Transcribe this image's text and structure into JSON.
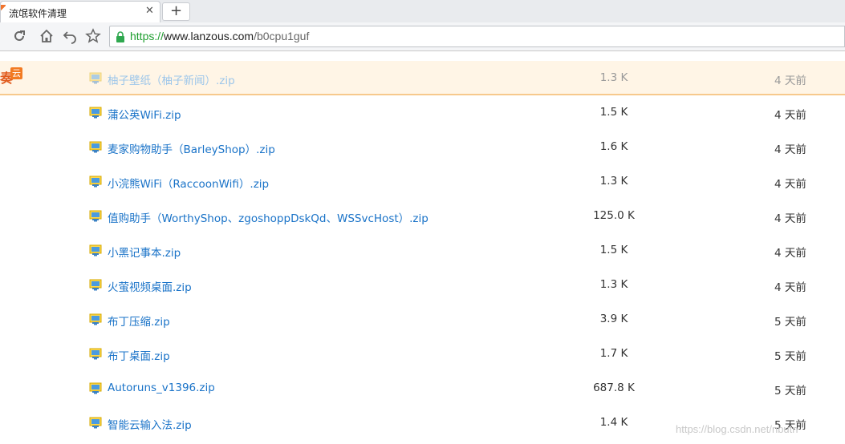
{
  "browser": {
    "tab": {
      "title": "流氓软件清理",
      "close_glyph": "✕"
    },
    "new_tab_glyph": "+",
    "toolbar": {
      "icons": [
        "reload-icon",
        "home-icon",
        "back-icon",
        "bookmark-star-icon"
      ]
    },
    "address": {
      "scheme": "https://",
      "host": "www.lanzous.com",
      "path": "/b0cpu1guf"
    }
  },
  "page": {
    "logo_fragment": "奏",
    "logo_badge": "云",
    "files": [
      {
        "name": "柚子壁纸（柚子新闻）.zip",
        "size": "1.3 K",
        "time": "4 天前"
      },
      {
        "name": "蒲公英WiFi.zip",
        "size": "1.5 K",
        "time": "4 天前"
      },
      {
        "name": "麦家购物助手（BarleyShop）.zip",
        "size": "1.6 K",
        "time": "4 天前"
      },
      {
        "name": "小浣熊WiFi（RaccoonWifi）.zip",
        "size": "1.3 K",
        "time": "4 天前"
      },
      {
        "name": "值购助手（WorthyShop、zgoshoppDskQd、WSSvcHost）.zip",
        "size": "125.0 K",
        "time": "4 天前"
      },
      {
        "name": "小黑记事本.zip",
        "size": "1.5 K",
        "time": "4 天前"
      },
      {
        "name": "火萤视频桌面.zip",
        "size": "1.3 K",
        "time": "4 天前"
      },
      {
        "name": "布丁压缩.zip",
        "size": "3.9 K",
        "time": "5 天前"
      },
      {
        "name": "布丁桌面.zip",
        "size": "1.7 K",
        "time": "5 天前"
      },
      {
        "name": "Autoruns_v1396.zip",
        "size": "687.8 K",
        "time": "5 天前"
      },
      {
        "name": "智能云输入法.zip",
        "size": "1.4 K",
        "time": "5 天前"
      }
    ],
    "file_icon": "file-zip-icon",
    "watermark": "https://blog.csdn.net/nbutn"
  },
  "colors": {
    "link": "#1a73c8",
    "highlight_bg": "#fff5e6",
    "scheme_green": "#1e9e2f",
    "brand_orange": "#f27a22"
  }
}
